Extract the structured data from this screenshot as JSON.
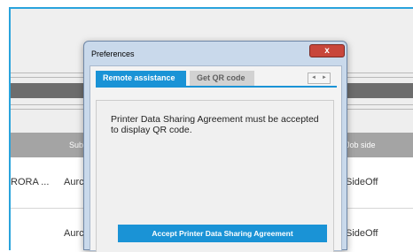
{
  "background_app": {
    "column_headers": {
      "subject": "Sub",
      "job_side": "Job side"
    },
    "rows": [
      {
        "name": "RORA ...",
        "subject": "Aurc",
        "job_side": "SideOff"
      },
      {
        "name": "",
        "subject": "Aurc",
        "job_side": "SideOff"
      }
    ]
  },
  "dialog": {
    "title": "Preferences",
    "close_label": "x",
    "tabs": [
      {
        "label": "Remote assistance",
        "active": true
      },
      {
        "label": "Get QR code",
        "active": false
      }
    ],
    "scroll_left": "◄",
    "scroll_right": "►",
    "message": "Printer Data Sharing Agreement must be accepted to display QR code.",
    "accept_button": "Accept Printer Data Sharing Agreement"
  },
  "colors": {
    "accent": "#1a93d6",
    "frame_border": "#29a3dc",
    "close_button": "#c8463b"
  }
}
